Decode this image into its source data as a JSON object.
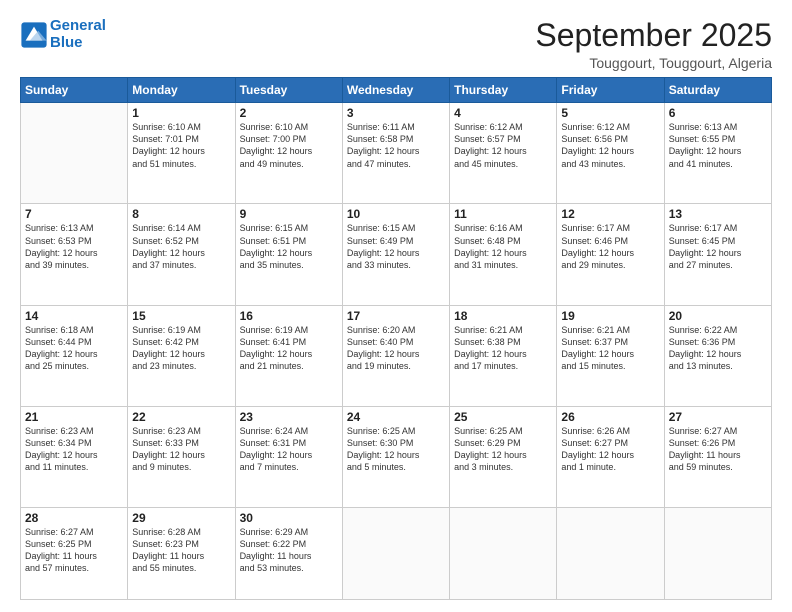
{
  "header": {
    "logo_line1": "General",
    "logo_line2": "Blue",
    "month": "September 2025",
    "location": "Touggourt, Touggourt, Algeria"
  },
  "days_of_week": [
    "Sunday",
    "Monday",
    "Tuesday",
    "Wednesday",
    "Thursday",
    "Friday",
    "Saturday"
  ],
  "weeks": [
    [
      {
        "day": "",
        "info": ""
      },
      {
        "day": "1",
        "info": "Sunrise: 6:10 AM\nSunset: 7:01 PM\nDaylight: 12 hours\nand 51 minutes."
      },
      {
        "day": "2",
        "info": "Sunrise: 6:10 AM\nSunset: 7:00 PM\nDaylight: 12 hours\nand 49 minutes."
      },
      {
        "day": "3",
        "info": "Sunrise: 6:11 AM\nSunset: 6:58 PM\nDaylight: 12 hours\nand 47 minutes."
      },
      {
        "day": "4",
        "info": "Sunrise: 6:12 AM\nSunset: 6:57 PM\nDaylight: 12 hours\nand 45 minutes."
      },
      {
        "day": "5",
        "info": "Sunrise: 6:12 AM\nSunset: 6:56 PM\nDaylight: 12 hours\nand 43 minutes."
      },
      {
        "day": "6",
        "info": "Sunrise: 6:13 AM\nSunset: 6:55 PM\nDaylight: 12 hours\nand 41 minutes."
      }
    ],
    [
      {
        "day": "7",
        "info": "Sunrise: 6:13 AM\nSunset: 6:53 PM\nDaylight: 12 hours\nand 39 minutes."
      },
      {
        "day": "8",
        "info": "Sunrise: 6:14 AM\nSunset: 6:52 PM\nDaylight: 12 hours\nand 37 minutes."
      },
      {
        "day": "9",
        "info": "Sunrise: 6:15 AM\nSunset: 6:51 PM\nDaylight: 12 hours\nand 35 minutes."
      },
      {
        "day": "10",
        "info": "Sunrise: 6:15 AM\nSunset: 6:49 PM\nDaylight: 12 hours\nand 33 minutes."
      },
      {
        "day": "11",
        "info": "Sunrise: 6:16 AM\nSunset: 6:48 PM\nDaylight: 12 hours\nand 31 minutes."
      },
      {
        "day": "12",
        "info": "Sunrise: 6:17 AM\nSunset: 6:46 PM\nDaylight: 12 hours\nand 29 minutes."
      },
      {
        "day": "13",
        "info": "Sunrise: 6:17 AM\nSunset: 6:45 PM\nDaylight: 12 hours\nand 27 minutes."
      }
    ],
    [
      {
        "day": "14",
        "info": "Sunrise: 6:18 AM\nSunset: 6:44 PM\nDaylight: 12 hours\nand 25 minutes."
      },
      {
        "day": "15",
        "info": "Sunrise: 6:19 AM\nSunset: 6:42 PM\nDaylight: 12 hours\nand 23 minutes."
      },
      {
        "day": "16",
        "info": "Sunrise: 6:19 AM\nSunset: 6:41 PM\nDaylight: 12 hours\nand 21 minutes."
      },
      {
        "day": "17",
        "info": "Sunrise: 6:20 AM\nSunset: 6:40 PM\nDaylight: 12 hours\nand 19 minutes."
      },
      {
        "day": "18",
        "info": "Sunrise: 6:21 AM\nSunset: 6:38 PM\nDaylight: 12 hours\nand 17 minutes."
      },
      {
        "day": "19",
        "info": "Sunrise: 6:21 AM\nSunset: 6:37 PM\nDaylight: 12 hours\nand 15 minutes."
      },
      {
        "day": "20",
        "info": "Sunrise: 6:22 AM\nSunset: 6:36 PM\nDaylight: 12 hours\nand 13 minutes."
      }
    ],
    [
      {
        "day": "21",
        "info": "Sunrise: 6:23 AM\nSunset: 6:34 PM\nDaylight: 12 hours\nand 11 minutes."
      },
      {
        "day": "22",
        "info": "Sunrise: 6:23 AM\nSunset: 6:33 PM\nDaylight: 12 hours\nand 9 minutes."
      },
      {
        "day": "23",
        "info": "Sunrise: 6:24 AM\nSunset: 6:31 PM\nDaylight: 12 hours\nand 7 minutes."
      },
      {
        "day": "24",
        "info": "Sunrise: 6:25 AM\nSunset: 6:30 PM\nDaylight: 12 hours\nand 5 minutes."
      },
      {
        "day": "25",
        "info": "Sunrise: 6:25 AM\nSunset: 6:29 PM\nDaylight: 12 hours\nand 3 minutes."
      },
      {
        "day": "26",
        "info": "Sunrise: 6:26 AM\nSunset: 6:27 PM\nDaylight: 12 hours\nand 1 minute."
      },
      {
        "day": "27",
        "info": "Sunrise: 6:27 AM\nSunset: 6:26 PM\nDaylight: 11 hours\nand 59 minutes."
      }
    ],
    [
      {
        "day": "28",
        "info": "Sunrise: 6:27 AM\nSunset: 6:25 PM\nDaylight: 11 hours\nand 57 minutes."
      },
      {
        "day": "29",
        "info": "Sunrise: 6:28 AM\nSunset: 6:23 PM\nDaylight: 11 hours\nand 55 minutes."
      },
      {
        "day": "30",
        "info": "Sunrise: 6:29 AM\nSunset: 6:22 PM\nDaylight: 11 hours\nand 53 minutes."
      },
      {
        "day": "",
        "info": ""
      },
      {
        "day": "",
        "info": ""
      },
      {
        "day": "",
        "info": ""
      },
      {
        "day": "",
        "info": ""
      }
    ]
  ]
}
